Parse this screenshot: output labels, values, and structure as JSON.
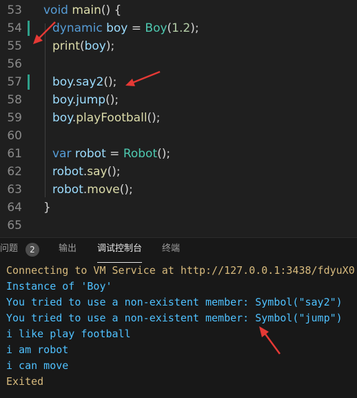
{
  "colors": {
    "background": "#1f1f1f",
    "keyword": "#569cd6",
    "variable": "#9cdcfe",
    "function": "#dcdcaa",
    "type": "#4ec9b0",
    "number": "#b5cea8",
    "arrow": "#e53935",
    "console_yellow": "#d7ba7d",
    "console_blue": "#4fc1ff",
    "modified_marker": "#2ea08a"
  },
  "editor": {
    "lines": [
      {
        "no": "53",
        "tokens": {
          "a": "void",
          "b": " main",
          "c": "() {"
        }
      },
      {
        "no": "54",
        "tokens": {
          "a": "dynamic",
          "b": " boy",
          "c": " = ",
          "d": "Boy",
          "e": "(",
          "f": "1.2",
          "g": ");"
        }
      },
      {
        "no": "55",
        "tokens": {
          "a": "print",
          "b": "(",
          "c": "boy",
          "d": ");"
        }
      },
      {
        "no": "56"
      },
      {
        "no": "57",
        "tokens": {
          "a": "boy",
          "b": ".",
          "c": "say2",
          "d": "();"
        }
      },
      {
        "no": "58",
        "tokens": {
          "a": "boy",
          "b": ".",
          "c": "jump",
          "d": "();"
        }
      },
      {
        "no": "59",
        "tokens": {
          "a": "boy",
          "b": ".",
          "c": "playFootball",
          "d": "();"
        }
      },
      {
        "no": "60"
      },
      {
        "no": "61",
        "tokens": {
          "a": "var",
          "b": " robot",
          "c": " = ",
          "d": "Robot",
          "e": "();"
        }
      },
      {
        "no": "62",
        "tokens": {
          "a": "robot",
          "b": ".",
          "c": "say",
          "d": "();"
        }
      },
      {
        "no": "63",
        "tokens": {
          "a": "robot",
          "b": ".",
          "c": "move",
          "d": "();"
        }
      },
      {
        "no": "64",
        "tokens": {
          "a": "}"
        }
      },
      {
        "no": "65"
      }
    ]
  },
  "panel": {
    "tabs": {
      "problems": "问题",
      "problems_count": "2",
      "output": "输出",
      "debug_console": "调试控制台",
      "terminal": "终端"
    },
    "console": [
      "Connecting to VM Service at http://127.0.0.1:3438/fdyuX0",
      "Instance of 'Boy'",
      "You tried to use a non-existent member: Symbol(\"say2\")",
      "You tried to use a non-existent member: Symbol(\"jump\")",
      "i like play football",
      "i am robot",
      "i can move",
      "Exited"
    ]
  }
}
